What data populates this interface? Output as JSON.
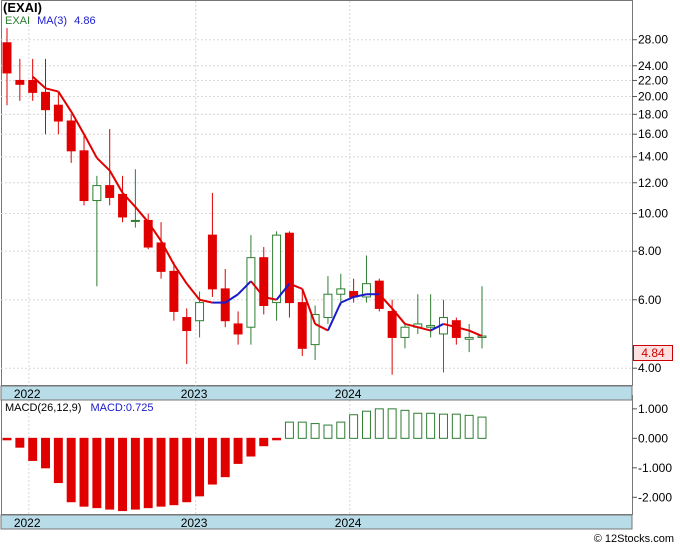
{
  "title": "(EXAI)",
  "legend": {
    "ticker": "EXAI",
    "ma_label": "MA(3)",
    "ma_value": "4.86",
    "macd_params": "MACD(26,12,9)",
    "macd_value": "MACD:0.725"
  },
  "last_price_label": "4.84",
  "watermark": "© 12Stocks.com",
  "colors": {
    "up": "#2e7d32",
    "down": "#e00000",
    "ma_up": "#1a1acc",
    "ma_down": "#e00000",
    "axis_band": "#b8dde9"
  },
  "chart_data": [
    {
      "type": "candlestick",
      "title": "(EXAI)",
      "y_scale": "log",
      "ylim": [
        3.6,
        33
      ],
      "y_ticks": [
        "4.00",
        "6.00",
        "8.00",
        "10.00",
        "12.00",
        "14.00",
        "16.00",
        "18.00",
        "20.00",
        "22.00",
        "24.00",
        "28.00"
      ],
      "x_labels": [
        {
          "label": "2022",
          "index": 2
        },
        {
          "label": "2023",
          "index": 15
        },
        {
          "label": "2024",
          "index": 27
        }
      ],
      "candles": [
        {
          "o": 27.5,
          "h": 30,
          "l": 19,
          "c": 23
        },
        {
          "o": 22,
          "h": 25,
          "l": 19.5,
          "c": 21.5
        },
        {
          "o": 22,
          "h": 25,
          "l": 19.5,
          "c": 20.5
        },
        {
          "o": 20.5,
          "h": 25,
          "l": 16,
          "c": 18.5
        },
        {
          "o": 19,
          "h": 20.5,
          "l": 16,
          "c": 17.3
        },
        {
          "o": 17.3,
          "h": 18,
          "l": 13.5,
          "c": 14.5
        },
        {
          "o": 14.5,
          "h": 16,
          "l": 10.5,
          "c": 10.8
        },
        {
          "o": 10.8,
          "h": 12.5,
          "l": 6.5,
          "c": 11.8
        },
        {
          "o": 11.8,
          "h": 16.5,
          "l": 10.5,
          "c": 11
        },
        {
          "o": 11.2,
          "h": 12.5,
          "l": 9.5,
          "c": 9.8
        },
        {
          "o": 9.6,
          "h": 13,
          "l": 9.2,
          "c": 9.6
        },
        {
          "o": 9.6,
          "h": 10,
          "l": 8.1,
          "c": 8.2
        },
        {
          "o": 8.4,
          "h": 9.5,
          "l": 6.8,
          "c": 7.1
        },
        {
          "o": 7.1,
          "h": 7.5,
          "l": 5.3,
          "c": 5.6
        },
        {
          "o": 5.4,
          "h": 5.7,
          "l": 4.1,
          "c": 5.0
        },
        {
          "o": 5.3,
          "h": 6.3,
          "l": 4.8,
          "c": 5.9
        },
        {
          "o": 8.8,
          "h": 11.3,
          "l": 6.1,
          "c": 6.4
        },
        {
          "o": 6.4,
          "h": 7.2,
          "l": 5.1,
          "c": 5.3
        },
        {
          "o": 5.2,
          "h": 5.6,
          "l": 4.6,
          "c": 4.9
        },
        {
          "o": 5.1,
          "h": 8.8,
          "l": 4.6,
          "c": 7.7
        },
        {
          "o": 7.7,
          "h": 8.2,
          "l": 5.5,
          "c": 5.8
        },
        {
          "o": 5.9,
          "h": 9,
          "l": 5.3,
          "c": 8.8
        },
        {
          "o": 8.9,
          "h": 9,
          "l": 5.4,
          "c": 5.9
        },
        {
          "o": 5.9,
          "h": 6.4,
          "l": 4.3,
          "c": 4.5
        },
        {
          "o": 4.6,
          "h": 5.8,
          "l": 4.2,
          "c": 5.5
        },
        {
          "o": 5.4,
          "h": 6.9,
          "l": 5.2,
          "c": 6.2
        },
        {
          "o": 6.2,
          "h": 7.0,
          "l": 5.8,
          "c": 6.4
        },
        {
          "o": 6.3,
          "h": 6.8,
          "l": 5.9,
          "c": 6.1
        },
        {
          "o": 6.1,
          "h": 7.8,
          "l": 5.9,
          "c": 6.6
        },
        {
          "o": 6.7,
          "h": 6.8,
          "l": 5.6,
          "c": 5.7
        },
        {
          "o": 5.6,
          "h": 6.0,
          "l": 3.85,
          "c": 4.8
        },
        {
          "o": 4.8,
          "h": 5.2,
          "l": 4.5,
          "c": 5.1
        },
        {
          "o": 5.1,
          "h": 6.2,
          "l": 4.9,
          "c": 5.2
        },
        {
          "o": 5.1,
          "h": 6.2,
          "l": 4.8,
          "c": 5.15
        },
        {
          "o": 4.9,
          "h": 6.0,
          "l": 3.9,
          "c": 5.4
        },
        {
          "o": 5.3,
          "h": 5.4,
          "l": 4.6,
          "c": 4.8
        },
        {
          "o": 4.75,
          "h": 5.2,
          "l": 4.4,
          "c": 4.8
        },
        {
          "o": 4.8,
          "h": 6.5,
          "l": 4.5,
          "c": 4.84
        }
      ],
      "ma3": [
        null,
        null,
        22.5,
        21.0,
        20.6,
        18.3,
        16.0,
        13.9,
        12.9,
        11.3,
        10.4,
        9.5,
        8.5,
        7.4,
        6.6,
        6.0,
        5.9,
        5.9,
        6.2,
        6.7,
        6.1,
        6.0,
        6.6,
        6.4,
        5.2,
        5.0,
        5.9,
        6.1,
        6.2,
        6.2,
        5.7,
        5.2,
        5.1,
        5.0,
        5.2,
        5.1,
        5.0,
        4.84
      ]
    },
    {
      "type": "bar",
      "title": "MACD(26,12,9)",
      "ylim": [
        -2.6,
        1.3
      ],
      "y_ticks": [
        "1.000",
        "0.000",
        "-1.000",
        "-2.000"
      ],
      "x_labels": [
        {
          "label": "2022",
          "index": 2
        },
        {
          "label": "2023",
          "index": 15
        },
        {
          "label": "2024",
          "index": 27
        }
      ],
      "values": [
        -0.05,
        -0.3,
        -0.75,
        -1.0,
        -1.5,
        -2.15,
        -2.3,
        -2.35,
        -2.4,
        -2.45,
        -2.4,
        -2.35,
        -2.3,
        -2.25,
        -2.15,
        -1.95,
        -1.55,
        -1.3,
        -0.85,
        -0.6,
        -0.25,
        -0.05,
        0.55,
        0.55,
        0.5,
        0.45,
        0.55,
        0.8,
        0.92,
        1.0,
        1.0,
        0.95,
        0.85,
        0.85,
        0.82,
        0.82,
        0.78,
        0.72
      ]
    }
  ]
}
